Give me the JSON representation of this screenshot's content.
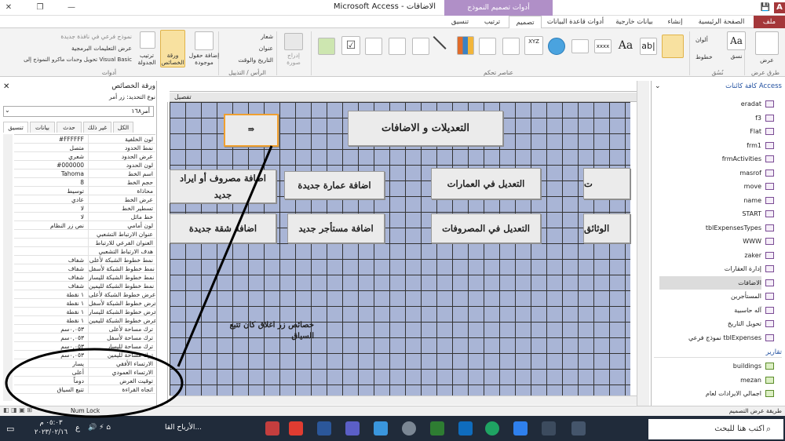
{
  "window": {
    "title": "Microsoft Access - الاضافات",
    "context_tab_title": "أدوات تصميم النموذج"
  },
  "tabs": [
    {
      "label": "ملف"
    },
    {
      "label": "الصفحة الرئيسية"
    },
    {
      "label": "إنشاء"
    },
    {
      "label": "بيانات خارجية"
    },
    {
      "label": "أدوات قاعدة البيانات"
    },
    {
      "label": "تصميم"
    },
    {
      "label": "ترتيب"
    },
    {
      "label": "تنسيق"
    }
  ],
  "ribbon": {
    "groups": {
      "views": "طرق عرض",
      "themes": "نُسُق",
      "controls": "عناصر تحكم",
      "header_footer": "الرأس / التذييل",
      "tools": "أدوات"
    },
    "views_button": "عرض",
    "themes_button": "نسق",
    "colors": "ألوان",
    "fonts": "خطوط",
    "insert_image": "إدراج صورة",
    "logo": "شعار",
    "title": "عنوان",
    "date_time": "التاريخ والوقت",
    "add_fields": "إضافة حقول موجودة",
    "property_sheet": "ورقة الخصائص",
    "tab_order": "ترتيب الجدولة",
    "subform_new_window": "نموذج فرعي في نافذة جديدة",
    "view_code": "عرض التعليمات البرمجية",
    "convert_macros": "تحويل وحدات ماكرو النموذج إلى Visual Basic"
  },
  "property_sheet": {
    "title": "ورقة الخصائص",
    "selection_type": "نوع التحديد: زر أمر",
    "selected": "أمر١٦٨",
    "tabs": [
      "تنسيق",
      "بيانات",
      "حدث",
      "غير ذلك",
      "الكل"
    ],
    "rows": [
      {
        "name": "لون الخلفية",
        "value": "#FFFFFF"
      },
      {
        "name": "نمط الحدود",
        "value": "متصل"
      },
      {
        "name": "عرض الحدود",
        "value": "شعري"
      },
      {
        "name": "لون الحدود",
        "value": "#000000"
      },
      {
        "name": "اسم الخط",
        "value": "Tahoma"
      },
      {
        "name": "حجم الخط",
        "value": "8"
      },
      {
        "name": "محاذاة",
        "value": "توسيط"
      },
      {
        "name": "عرض الخط",
        "value": "عادي"
      },
      {
        "name": "تسطير الخط",
        "value": "لا"
      },
      {
        "name": "خط مائل",
        "value": "لا"
      },
      {
        "name": "لون أمامي",
        "value": "نص زر النظام"
      },
      {
        "name": "عنوان الارتباط التشعبي",
        "value": ""
      },
      {
        "name": "العنوان الفرعي للارتباط",
        "value": ""
      },
      {
        "name": "هدف الارتباط التشعبي",
        "value": ""
      },
      {
        "name": "نمط خطوط الشبكة لأعلى",
        "value": "شفاف"
      },
      {
        "name": "نمط خطوط الشبكة لأسفل",
        "value": "شفاف"
      },
      {
        "name": "نمط خطوط الشبكة لليسار",
        "value": "شفاف"
      },
      {
        "name": "نمط خطوط الشبكة لليمين",
        "value": "شفاف"
      },
      {
        "name": "عرض خطوط الشبكة لأعلى",
        "value": "١ نقطة"
      },
      {
        "name": "عرض خطوط الشبكة لأسفل",
        "value": "١ نقطة"
      },
      {
        "name": "عرض خطوط الشبكة لليسار",
        "value": "١ نقطة"
      },
      {
        "name": "عرض خطوط الشبكة لليمين",
        "value": "١ نقطة"
      },
      {
        "name": "ترك مساحة لأعلى",
        "value": "٠,٠٥٣سم"
      },
      {
        "name": "ترك مساحة لأسفل",
        "value": "٠,٠٥٣سم"
      },
      {
        "name": "ترك مساحة لليسار",
        "value": "٠,٠٥٣سم"
      },
      {
        "name": "ترك مساحة لليمين",
        "value": "٠,٠٥٣سم"
      },
      {
        "name": "الارتساء الأفقي",
        "value": "يسار"
      },
      {
        "name": "الارتساء العمودي",
        "value": "أعلى"
      },
      {
        "name": "توقيت العرض",
        "value": "دوماً"
      },
      {
        "name": "اتجاه القراءة",
        "value": "تتبع السياق"
      }
    ]
  },
  "design": {
    "section": "تفصيل",
    "annotation": "خصائص زر اغلاق كان تتبع السياق",
    "buttons": {
      "title": "التعديلات و الاضافات",
      "add_expense": "اضافة مصروف أو ايراد جديد",
      "add_building": "اضافة عمارة جديدة",
      "edit_buildings": "التعديل في العمارات",
      "foundation": "ت المؤسسة",
      "add_apartment": "اضافة شقة جديدة",
      "add_tenant": "اضافة مستأجر جديد",
      "edit_expenses": "التعديل في المصروفات",
      "documents": "الوثائق"
    }
  },
  "nav_pane": {
    "title": "كافة كائنات Access",
    "forms": [
      "eradat",
      "f3",
      "Flat",
      "frm1",
      "frmActivities",
      "masrof",
      "move",
      "name",
      "START",
      "tblExpensesTypes",
      "WWW",
      "zaker",
      "إدارة العقارات",
      "الاضافات",
      "المستأجرين",
      "آله حاسبية",
      "تحويل التاريخ",
      "نموذج فرعي tblExpenses"
    ],
    "reports_header": "تقارير",
    "reports": [
      "buildings",
      "mezan",
      "اجمالي الايرادات لعام"
    ]
  },
  "status": {
    "left": "طريقة عرض التصميم",
    "numlock": "Num Lock"
  },
  "taskbar": {
    "search_placeholder": "اكتب هنا للبحث",
    "time": "٠٥:٠٣ م",
    "date": "٢٠٢٣/٠٢/١٦",
    "news": "الأرباح القا...",
    "lang": "ع"
  },
  "colors": {
    "file_tab": "#a4373a",
    "context_tab": "#b08fc7",
    "grid": "#a9b5d6",
    "taskbar": "#202b3a"
  }
}
